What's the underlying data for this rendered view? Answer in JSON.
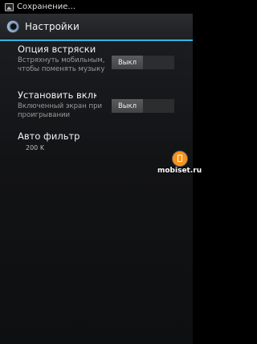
{
  "status_bar": {
    "icon": "image-icon",
    "text": "Сохранение..."
  },
  "action_bar": {
    "icon": "app-icon",
    "title": "Настройки"
  },
  "preferences": [
    {
      "title": "Опция встряски",
      "summary": "Встряхнуть мобильным, чтобы поменять музыку",
      "toggle": "Выкл"
    },
    {
      "title": "Установить вклю",
      "summary": "Включенный экран при проигрывании",
      "toggle": "Выкл"
    },
    {
      "title": "Авто фильтр",
      "summary": "200 K"
    }
  ],
  "watermark": {
    "text": "mobiset.ru",
    "color": "#f7941d"
  },
  "colors": {
    "accent": "#33b5e5",
    "background": "#000000"
  }
}
